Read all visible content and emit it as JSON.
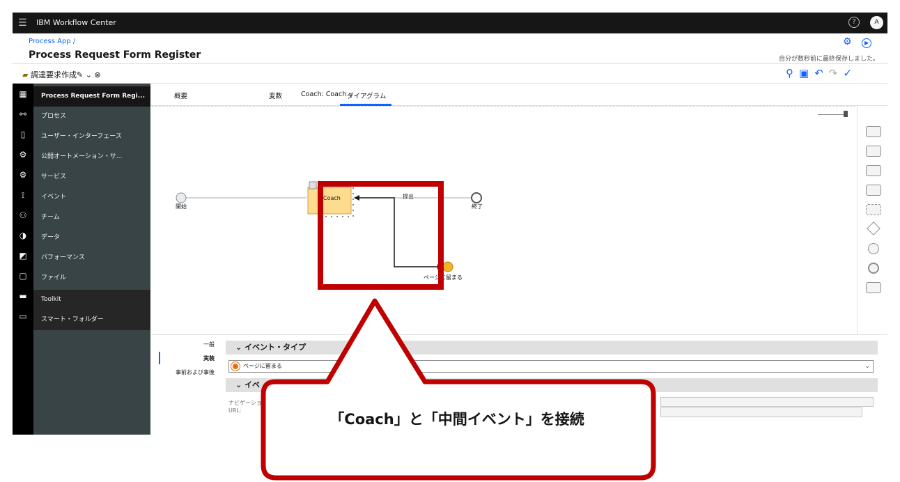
{
  "topbar": {
    "menu_icon": "hamburger-icon",
    "brand": "IBM Workflow Center",
    "help": "?",
    "avatar": "A"
  },
  "header": {
    "breadcrumb": "Process App /",
    "title": "Process Request Form Register",
    "saved_status": "自分が数秒前に最終保存しました。",
    "snapshot": "調達要求作成✎ ⌄ ⊗"
  },
  "sidebar": {
    "items": [
      {
        "label": "Process Request Form Regi...",
        "icon": "grid-icon"
      },
      {
        "label": "プロセス",
        "icon": "flow-icon"
      },
      {
        "label": "ユーザー・インターフェース",
        "icon": "phone-icon"
      },
      {
        "label": "公開オートメーション・サ...",
        "icon": "gear-icon"
      },
      {
        "label": "サービス",
        "icon": "gears-icon"
      },
      {
        "label": "イベント",
        "icon": "event-icon"
      },
      {
        "label": "チーム",
        "icon": "team-icon"
      },
      {
        "label": "データ",
        "icon": "data-icon"
      },
      {
        "label": "パフォーマンス",
        "icon": "chart-icon"
      },
      {
        "label": "ファイル",
        "icon": "file-icon"
      },
      {
        "label": "Toolkit",
        "icon": "toolbox-icon"
      },
      {
        "label": "スマート・フォルダー",
        "icon": "folder-icon"
      }
    ]
  },
  "tabs": [
    {
      "label": "概要"
    },
    {
      "label": "ダイアグラム"
    },
    {
      "label": "変数"
    },
    {
      "label": "Coach: Coach ⌄"
    }
  ],
  "diagram": {
    "start_label": "開始",
    "coach_label": "Coach",
    "submit_label": "提出",
    "end_label": "終了",
    "stay_label": "ページに留まる"
  },
  "properties": {
    "tabs": [
      {
        "label": "一般"
      },
      {
        "label": "実装"
      },
      {
        "label": "事前および事後"
      }
    ],
    "section1": "イベント・タイプ",
    "event_type_value": "ページに留まる",
    "section2": "イベ",
    "nav_label": "ナビゲーショ",
    "url_label": "URL:"
  },
  "callout": {
    "text": "「Coach」と「中間イベント」を接続"
  },
  "colors": {
    "accent": "#0f62fe",
    "callout_red": "#c00000",
    "sidebar": "#394446"
  }
}
